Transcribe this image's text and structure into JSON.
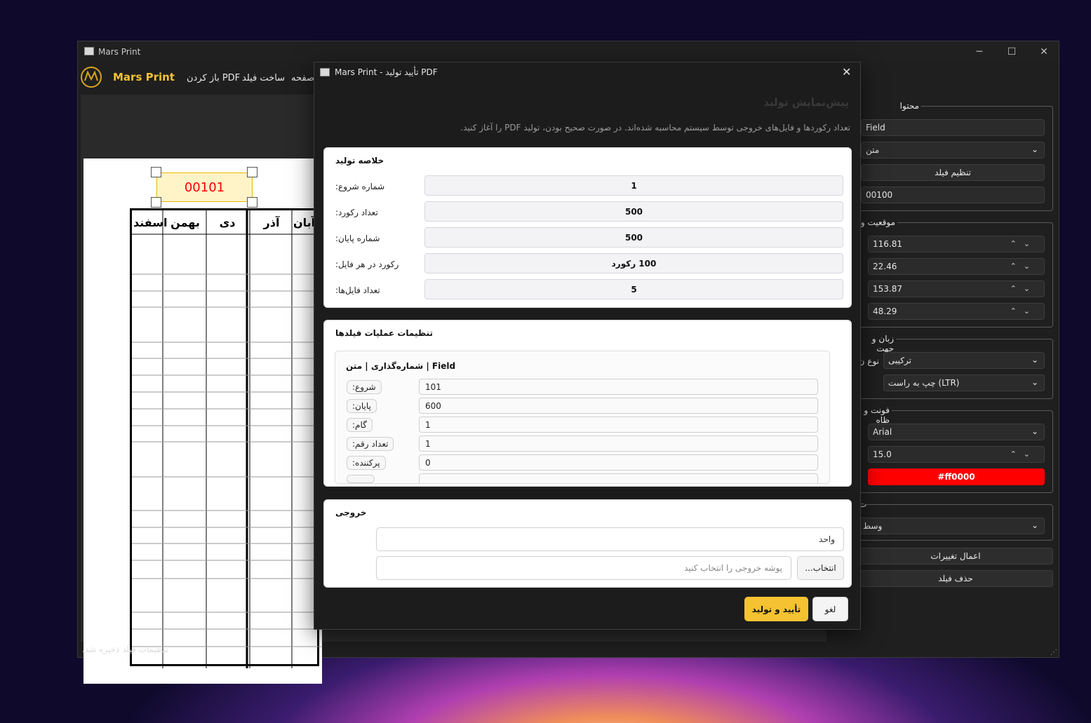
{
  "main_window": {
    "title": "Mars Print",
    "menu": [
      "باز کردن PDF",
      "ساخت فیلد",
      "صفحه"
    ],
    "brand": "Mars Print",
    "status": "تنظیمات فیلد ذخیره شد."
  },
  "canvas": {
    "selected_field_value": "00101",
    "table_headers": [
      "اسفند",
      "بهمن",
      "دی",
      "آذر",
      "آبان"
    ]
  },
  "right_panel": {
    "content_group": "محتوا",
    "field_name": "Field",
    "field_type": "متن",
    "setup_button": "تنظیم فیلد",
    "field_value": "00100",
    "position_group": "موقعیت و",
    "x": "116.81",
    "y": "22.46",
    "width": "153.87",
    "height": "48.29",
    "lang_group": "زبان و جهت",
    "lang_label": "نوع ن",
    "lang_value": "ترکیبی",
    "direction_value": "چپ به راست (LTR)",
    "font_group": "فونت و ظاه",
    "font_name": "Arial",
    "font_size": "15.0",
    "color_value": "#ff0000",
    "align_group": "ت",
    "align_value": "وسط",
    "apply_button": "اعمال تغییرات",
    "delete_button": "حذف فیلد"
  },
  "dialog": {
    "title": "Mars Print - تأیید تولید PDF",
    "header_faded": "پیش‌نمایش تولید",
    "description": "تعداد رکوردها و فایل‌های خروجی توسط سیستم محاسبه شده‌اند. در صورت صحیح بودن، تولید PDF را آغاز کنید.",
    "summary": {
      "title": "خلاصه تولید",
      "rows": [
        {
          "label": "شماره شروع:",
          "value": "1"
        },
        {
          "label": "تعداد رکورد:",
          "value": "500"
        },
        {
          "label": "شماره پایان:",
          "value": "500"
        },
        {
          "label": "رکورد در هر فایل:",
          "value": "100 رکورد"
        },
        {
          "label": "تعداد فایل‌ها:",
          "value": "5"
        }
      ]
    },
    "operations": {
      "title": "تنظیمات عملیات فیلدها",
      "field_header": "Field | شماره‌گذاری | متن",
      "rows": [
        {
          "label": "شروع:",
          "value": "101"
        },
        {
          "label": "پایان:",
          "value": "600"
        },
        {
          "label": "گام:",
          "value": "1"
        },
        {
          "label": "تعداد رقم:",
          "value": "1"
        },
        {
          "label": "پرکننده:",
          "value": "0"
        }
      ]
    },
    "output": {
      "title": "خروجی",
      "mode": "واحد",
      "folder_placeholder": "پوشه خروجی را انتخاب کنید",
      "browse_button": "...انتخاب"
    },
    "confirm_button": "تأیید و تولید",
    "cancel_button": "لغو"
  },
  "colors": {
    "accent": "#f5c232",
    "field_red": "#ff0000",
    "brand_yellow": "#f5c232"
  }
}
